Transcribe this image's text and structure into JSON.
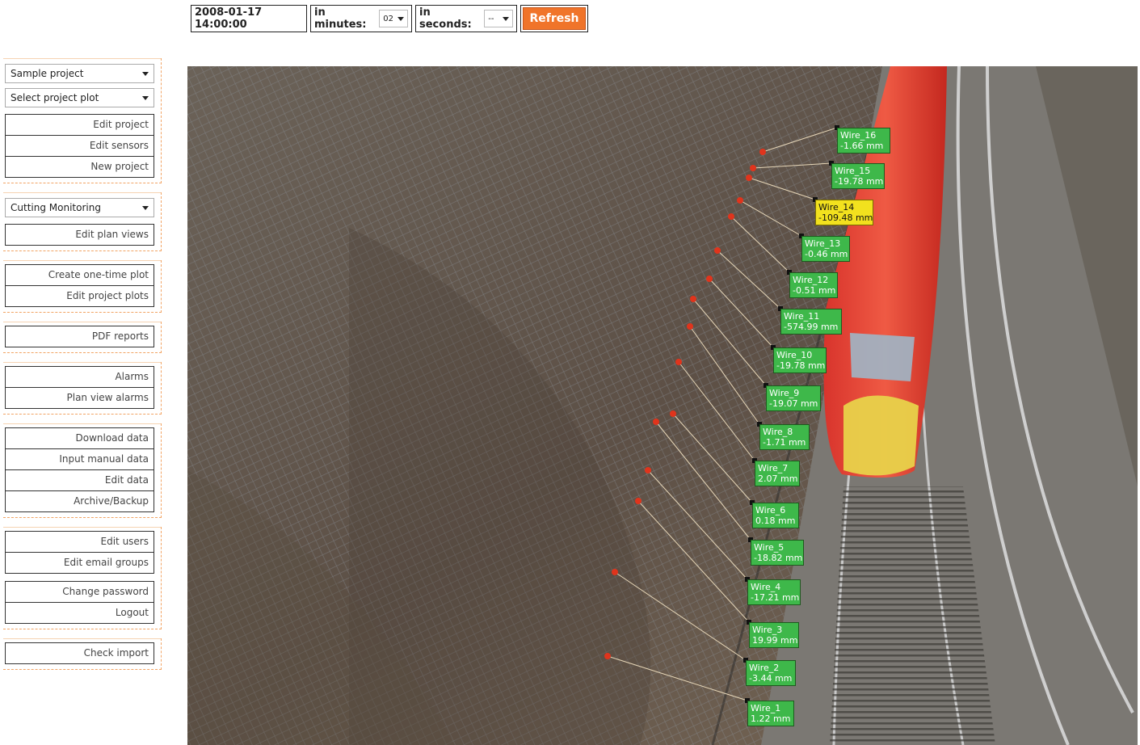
{
  "toolbar": {
    "datetime": "2008-01-17 14:00:00",
    "minutes_label": "in minutes:",
    "minutes_value": "02",
    "seconds_label": "in seconds:",
    "seconds_value": "--",
    "refresh_label": "Refresh"
  },
  "sidebar": {
    "project_select": "Sample project",
    "plot_select": "Select project plot",
    "group1": [
      "Edit project",
      "Edit sensors",
      "New project"
    ],
    "view_select": "Cutting Monitoring",
    "group2": [
      "Edit plan views"
    ],
    "group3": [
      "Create one-time plot",
      "Edit project plots"
    ],
    "group4": [
      "PDF reports"
    ],
    "group5": [
      "Alarms",
      "Plan view alarms"
    ],
    "group6": [
      "Download data",
      "Input manual data",
      "Edit data",
      "Archive/Backup"
    ],
    "group7": [
      "Edit users",
      "Edit email groups"
    ],
    "group8": [
      "Change password",
      "Logout"
    ],
    "group9": [
      "Check import"
    ]
  },
  "sensors": [
    {
      "name": "Wire_16",
      "value": "-1.66 mm",
      "status": "ok"
    },
    {
      "name": "Wire_15",
      "value": "-19.78 mm",
      "status": "ok"
    },
    {
      "name": "Wire_14",
      "value": "-109.48 mm",
      "status": "alert"
    },
    {
      "name": "Wire_13",
      "value": "-0.46 mm",
      "status": "ok"
    },
    {
      "name": "Wire_12",
      "value": "-0.51 mm",
      "status": "ok"
    },
    {
      "name": "Wire_11",
      "value": "-574.99 mm",
      "status": "ok"
    },
    {
      "name": "Wire_10",
      "value": "-19.78 mm",
      "status": "ok"
    },
    {
      "name": "Wire_9",
      "value": "-19.07 mm",
      "status": "ok"
    },
    {
      "name": "Wire_8",
      "value": "-1.71 mm",
      "status": "ok"
    },
    {
      "name": "Wire_7",
      "value": "2.07 mm",
      "status": "ok"
    },
    {
      "name": "Wire_6",
      "value": "0.18 mm",
      "status": "ok"
    },
    {
      "name": "Wire_5",
      "value": "-18.82 mm",
      "status": "ok"
    },
    {
      "name": "Wire_4",
      "value": "-17.21 mm",
      "status": "ok"
    },
    {
      "name": "Wire_3",
      "value": "19.99 mm",
      "status": "ok"
    },
    {
      "name": "Wire_2",
      "value": "-3.44 mm",
      "status": "ok"
    },
    {
      "name": "Wire_1",
      "value": "1.22 mm",
      "status": "ok"
    }
  ],
  "colors": {
    "accent": "#f0742a",
    "sensor_ok": "#3eb84a",
    "sensor_alert": "#f2e11e"
  }
}
